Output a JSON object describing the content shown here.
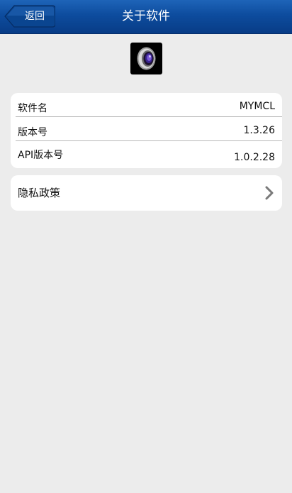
{
  "navbar": {
    "back_label": "返回",
    "title": "关于软件"
  },
  "app_icon": {
    "name": "camera-lens-icon"
  },
  "info": {
    "rows": [
      {
        "label": "软件名",
        "value": "MYMCL"
      },
      {
        "label": "版本号",
        "value": "1.3.26"
      },
      {
        "label": "API版本号",
        "value": "1.0.2.28"
      }
    ]
  },
  "privacy": {
    "label": "隐私政策",
    "icon": "chevron-right-icon"
  },
  "colors": {
    "navbar": "#0d4c9e",
    "background": "#ececec",
    "card": "#ffffff"
  }
}
